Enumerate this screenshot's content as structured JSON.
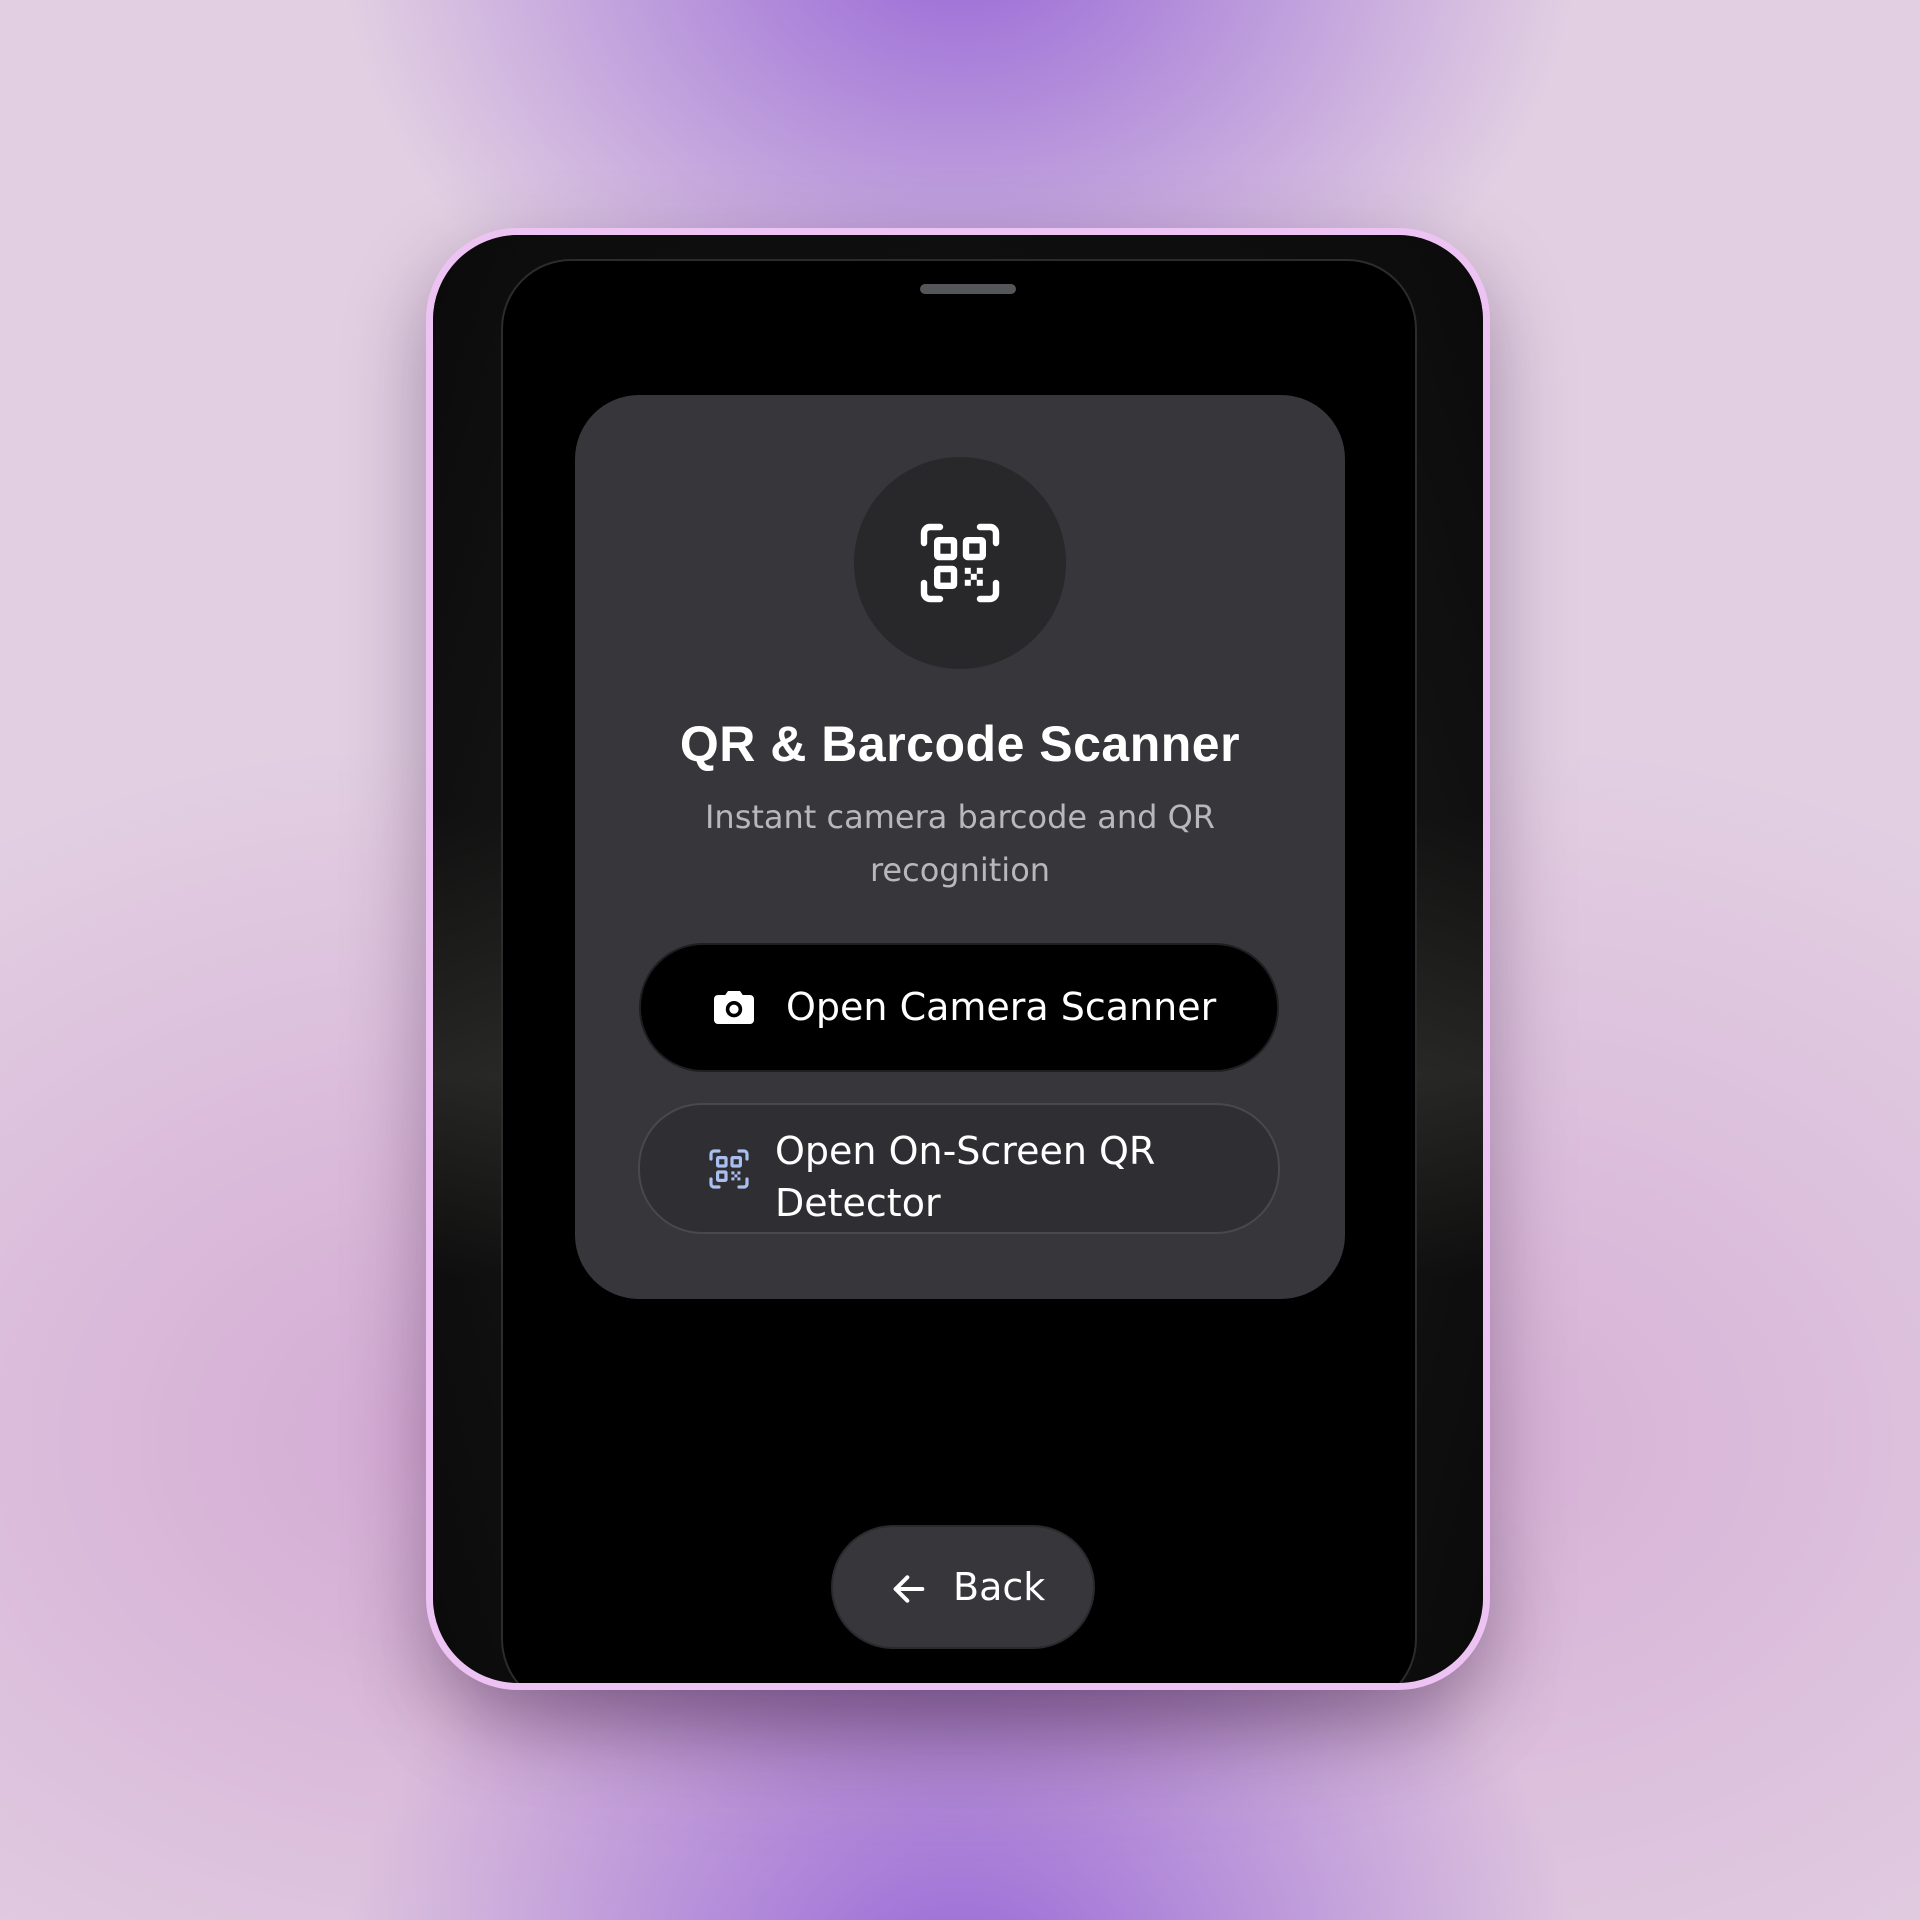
{
  "app": {
    "title": "QR & Barcode Scanner",
    "subtitle": "Instant camera barcode and QR recognition",
    "icon": "qr-scan-icon"
  },
  "actions": {
    "camera_scanner": {
      "label": "Open Camera Scanner",
      "icon": "camera-icon"
    },
    "onscreen_detector": {
      "label": "Open On-Screen QR Detector",
      "icon": "qr-scan-icon",
      "icon_color": "#a9bff0"
    }
  },
  "navigation": {
    "back_label": "Back",
    "back_icon": "arrow-left-icon"
  },
  "colors": {
    "device_frame": "#ecc3f2",
    "card": "#36363b",
    "primary_button": "#000000",
    "text": "#ffffff",
    "muted_text": "#b7b7bd"
  }
}
